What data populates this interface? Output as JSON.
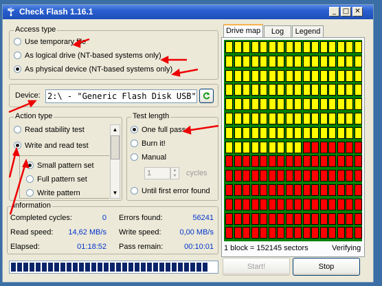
{
  "window": {
    "title": "Check Flash 1.16.1",
    "minimize": "_",
    "maximize": "□",
    "close": "✕"
  },
  "access_type": {
    "label": "Access type",
    "options": [
      "Use temporary file",
      "As logical drive (NT-based systems only)",
      "As physical device (NT-based systems only)"
    ],
    "selected": 2
  },
  "device": {
    "label": "Device:",
    "value": "2:\\ - \"Generic Flash Disk USB\"",
    "refresh_icon": "refresh-icon"
  },
  "action_type": {
    "label": "Action type",
    "options": [
      "Read stability test",
      "Write and read test"
    ],
    "selected": 1,
    "sub_options": [
      "Small pattern set",
      "Full pattern set",
      "Write pattern"
    ],
    "sub_selected": 0
  },
  "test_length": {
    "label": "Test length",
    "options": [
      "One full pass",
      "Burn it!",
      "Manual",
      "Until first error found"
    ],
    "selected": 0,
    "cycles_value": "1",
    "cycles_label": "cycles"
  },
  "information": {
    "label": "Information",
    "completed_cycles_label": "Completed cycles:",
    "completed_cycles": "0",
    "read_speed_label": "Read speed:",
    "read_speed": "14,62 MB/s",
    "elapsed_label": "Elapsed:",
    "elapsed": "01:18:52",
    "errors_found_label": "Errors found:",
    "errors_found": "56241",
    "write_speed_label": "Write speed:",
    "write_speed": "0,00 MB/s",
    "pass_remain_label": "Pass remain:",
    "pass_remain": "00:10:01"
  },
  "tabs": [
    "Drive map",
    "Log",
    "Legend"
  ],
  "active_tab": 0,
  "drive_map": {
    "columns": 16,
    "rows": 14,
    "yellow_full_rows": 7,
    "yellow_partial_in_row8": 9,
    "colors": {
      "ok": "#ffff00",
      "error": "#ff0000",
      "background": "#008000"
    },
    "block_info": "1 block = 152145 sectors",
    "status": "Verifying"
  },
  "progress": {
    "fraction": 0.96,
    "color": "#0a246a"
  },
  "buttons": {
    "start": "Start!",
    "stop": "Stop"
  }
}
